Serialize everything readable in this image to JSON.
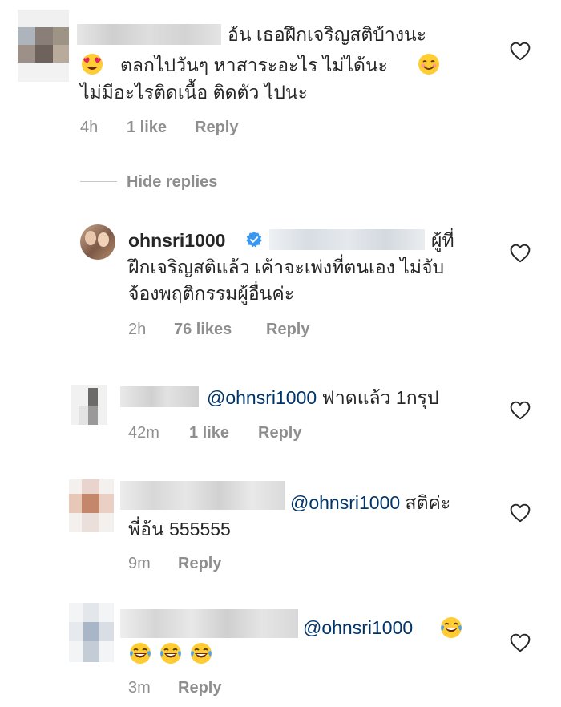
{
  "comments": [
    {
      "line1": "อ้น  เธอฝึกเจริญสติบ้างนะ",
      "line2": "ตลกไปวันๆ  หาสาระอะไร ไม่ได้นะ",
      "line3": "ไม่มีอะไรติดเนื้อ ติดตัว ไปนะ",
      "time": "4h",
      "likes": "1 like",
      "reply": "Reply",
      "emoji_left": "heart-eyes-emoji",
      "emoji_right": "smiling-face-emoji"
    },
    {
      "username": "ohnsri1000",
      "line1_end": "ผู้ที่",
      "line2": "ฝึกเจริญสติแล้ว เค้าจะเพ่งที่ตนเอง ไม่จับ",
      "line3": "จ้องพฤติกรรมผู้อื่นค่ะ",
      "time": "2h",
      "likes": "76 likes",
      "reply": "Reply",
      "verified_icon": "verified-badge-icon"
    },
    {
      "mention": "@ohnsri1000",
      "text": " ฟาดแล้ว 1กรุป",
      "time": "42m",
      "likes": "1 like",
      "reply": "Reply"
    },
    {
      "mention": "@ohnsri1000",
      "text": " สติค่ะ",
      "line2": "พี่อ้น 555555",
      "time": "9m",
      "reply": "Reply"
    },
    {
      "mention": "@ohnsri1000",
      "time": "3m",
      "reply": "Reply",
      "emoji": "face-with-tears-of-joy-emoji"
    }
  ],
  "hide_replies": "Hide replies",
  "colors": {
    "text": "#262626",
    "meta": "#8e8e8e",
    "mention": "#003569",
    "verified": "#3897f0"
  }
}
